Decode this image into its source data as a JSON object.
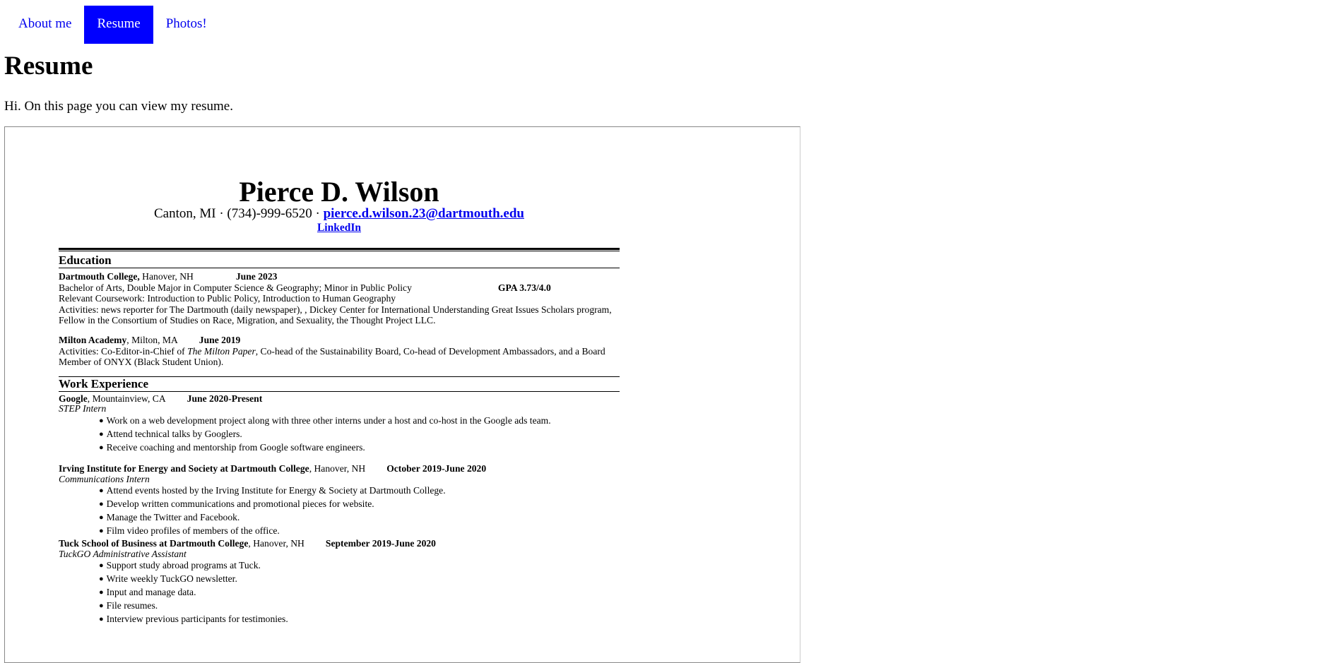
{
  "nav": {
    "items": [
      {
        "label": "About me",
        "active": false
      },
      {
        "label": "Resume",
        "active": true
      },
      {
        "label": "Photos!",
        "active": false
      }
    ]
  },
  "page": {
    "title": "Resume",
    "intro": "Hi. On this page you can view my resume."
  },
  "resume": {
    "name": "Pierce D. Wilson",
    "contact_prefix": "Canton, MI · (734)-999-6520 · ",
    "email": "pierce.d.wilson.23@dartmouth.edu",
    "linkedin": "LinkedIn",
    "education": {
      "heading": "Education",
      "dartmouth": {
        "school": "Dartmouth College,",
        "location": " Hanover, NH",
        "date": "June 2023",
        "degree": "Bachelor of Arts, Double Major in Computer Science & Geography; Minor in Public Policy",
        "gpa": "GPA 3.73/4.0",
        "coursework": "Relevant Coursework: Introduction to Public Policy, Introduction to Human Geography",
        "activities": "Activities: news reporter for The Dartmouth (daily newspaper), , Dickey Center for International Understanding Great Issues Scholars program, Fellow in the Consortium of Studies on Race, Migration, and Sexuality, the Thought Project LLC."
      },
      "milton": {
        "school": "Milton Academy",
        "location": ", Milton, MA",
        "date": "June 2019",
        "activities_prefix": "Activities: Co-Editor-in-Chief of ",
        "paper": "The Milton Paper",
        "activities_suffix": ", Co-head of the Sustainability Board, Co-head of Development Ambassadors, and a Board Member of ONYX (Black Student Union)."
      }
    },
    "work": {
      "heading": "Work Experience",
      "jobs": [
        {
          "org": "Google",
          "location": ", Mountainview, CA",
          "date": "June 2020-Present",
          "title": "STEP Intern",
          "bullets": [
            "Work on a web development project along with three other interns under a host and co-host in the Google ads team.",
            "Attend technical talks by Googlers.",
            "Receive coaching and mentorship from Google software engineers."
          ]
        },
        {
          "org": "Irving Institute for Energy and Society at Dartmouth College",
          "location": ", Hanover, NH",
          "date": "October 2019-June 2020",
          "title": "Communications Intern",
          "bullets": [
            "Attend events hosted by the Irving Institute for Energy & Society at Dartmouth College.",
            "Develop written communications and promotional pieces for website.",
            "Manage the Twitter and Facebook.",
            "Film video profiles of members of the office."
          ]
        },
        {
          "org": "Tuck School of Business at Dartmouth College",
          "location": ", Hanover, NH",
          "date": "September 2019-June 2020",
          "title": "TuckGO Administrative Assistant",
          "bullets": [
            "Support study abroad programs at Tuck.",
            "Write weekly TuckGO newsletter.",
            "Input and manage data.",
            "File resumes.",
            "Interview previous participants for testimonies."
          ]
        }
      ]
    }
  }
}
